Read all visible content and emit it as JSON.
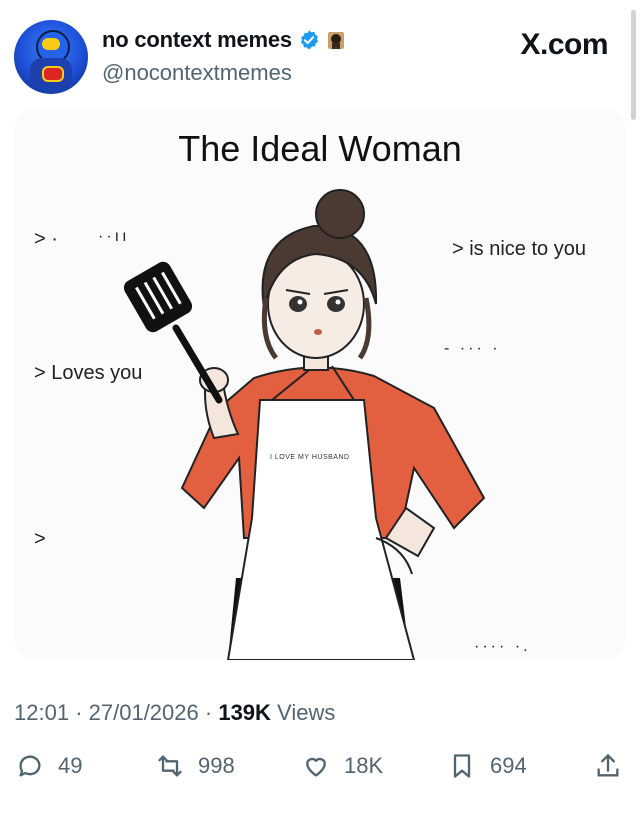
{
  "post": {
    "display_name": "no context memes",
    "handle": "@nocontextmemes",
    "source_logo": "X.com"
  },
  "meme": {
    "title": "The Ideal Woman",
    "label_loves": "> Loves you",
    "label_nice": "> is nice to you",
    "label_blank_1": "> ·",
    "label_blank_2": ">",
    "apron_text": "I LOVE MY HUSBAND"
  },
  "meta": {
    "time": "12:01",
    "sep1": "·",
    "date": "27/01/2026",
    "sep2": "·",
    "views_count": "139K",
    "views_label": "Views"
  },
  "actions": {
    "replies": "49",
    "reposts": "998",
    "likes": "18K",
    "bookmarks": "694"
  },
  "colors": {
    "verified": "#1d9bf0",
    "muted": "#536471",
    "shirt": "#e2603f"
  },
  "icons": [
    "verified-badge-icon",
    "flag-emoji-icon",
    "reply-icon",
    "repost-icon",
    "like-icon",
    "bookmark-icon",
    "share-icon"
  ]
}
